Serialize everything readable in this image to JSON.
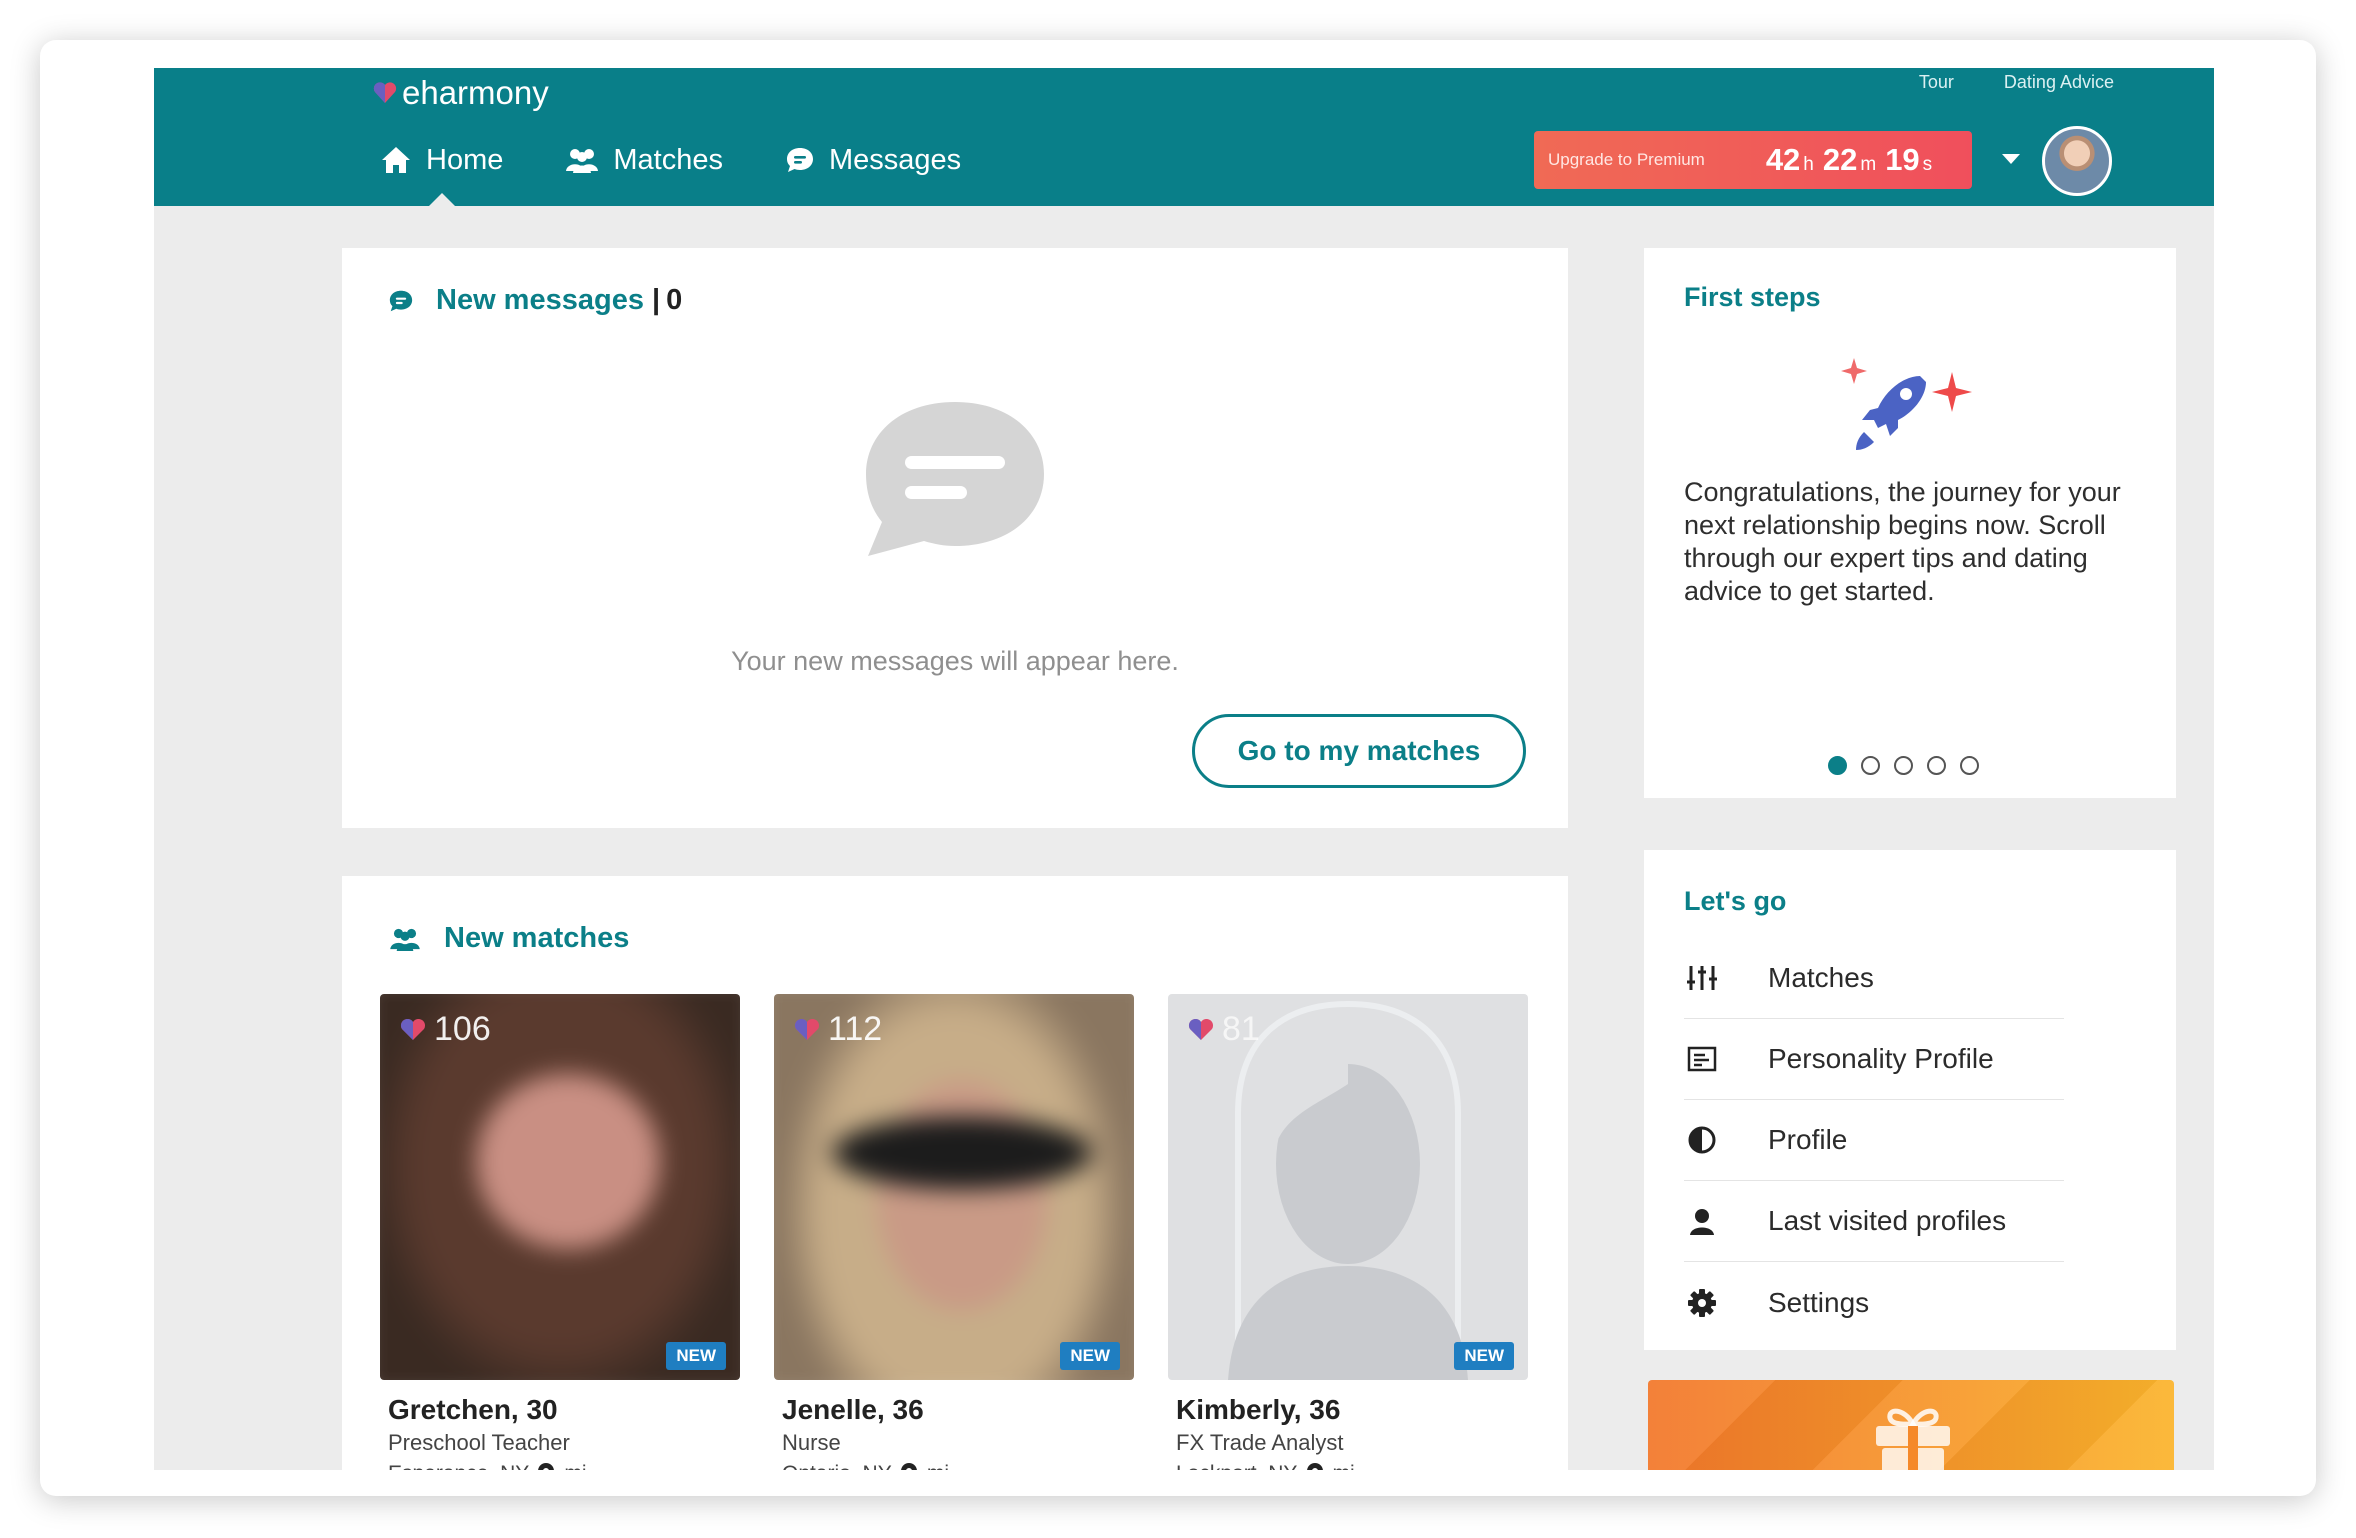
{
  "header": {
    "logo_text": "eharmony",
    "top_links": [
      "Tour",
      "Dating Advice"
    ],
    "nav": [
      {
        "label": "Home",
        "icon": "home-icon",
        "active": true
      },
      {
        "label": "Matches",
        "icon": "people-icon",
        "active": false
      },
      {
        "label": "Messages",
        "icon": "chat-icon",
        "active": false
      }
    ],
    "upgrade": {
      "label": "Upgrade to Premium",
      "hours": "42",
      "hours_unit": "h",
      "minutes": "22",
      "minutes_unit": "m",
      "seconds": "19",
      "seconds_unit": "s"
    },
    "avatar_icon": "user-avatar"
  },
  "messages": {
    "title": "New messages",
    "count": "0",
    "empty_text": "Your new messages will appear here.",
    "button_label": "Go to my matches"
  },
  "first_steps": {
    "title": "First steps",
    "icon": "rocket-icon",
    "text": "Congratulations, the journey for your next relationship begins now. Scroll through our expert tips and dating advice to get started.",
    "slides": 5,
    "active_slide": 1
  },
  "new_matches": {
    "title": "New matches",
    "items": [
      {
        "score": "106",
        "name": "Gretchen, 30",
        "job": "Preschool Teacher",
        "location": "Esperance, NY,",
        "distance_unit": "mi",
        "badge": "NEW"
      },
      {
        "score": "112",
        "name": "Jenelle, 36",
        "job": "Nurse",
        "location": "Ontario, NY,",
        "distance_unit": "mi",
        "badge": "NEW"
      },
      {
        "score": "81",
        "name": "Kimberly, 36",
        "job": "FX Trade Analyst",
        "location": "Lockport, NY,",
        "distance_unit": "mi",
        "badge": "NEW"
      }
    ]
  },
  "lets_go": {
    "title": "Let's go",
    "items": [
      {
        "label": "Matches",
        "icon": "sliders-icon"
      },
      {
        "label": "Personality Profile",
        "icon": "document-icon"
      },
      {
        "label": "Profile",
        "icon": "half-circle-icon"
      },
      {
        "label": "Last visited profiles",
        "icon": "person-icon"
      },
      {
        "label": "Settings",
        "icon": "gear-icon"
      }
    ]
  },
  "colors": {
    "brand_teal": "#097f89",
    "upgrade_red": "#f04f5c",
    "badge_blue": "#1f7ec1",
    "banner_orange": "#f79a2a"
  }
}
